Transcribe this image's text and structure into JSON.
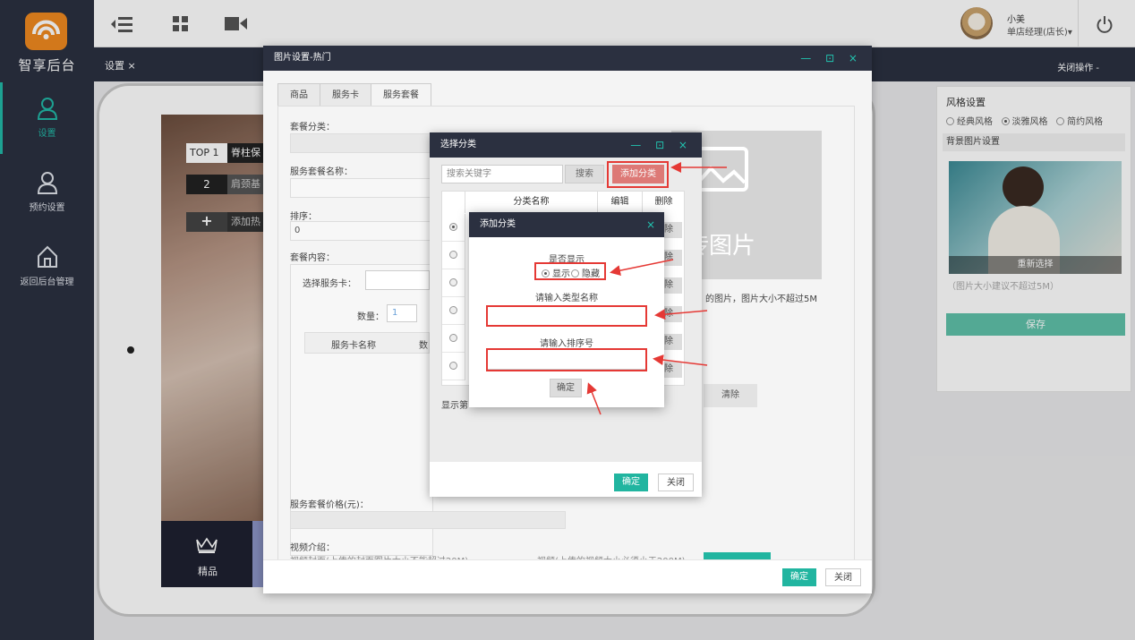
{
  "brand": {
    "name": "智享后台"
  },
  "sidebar": {
    "items": [
      {
        "label": "设置",
        "icon": "user-icon"
      },
      {
        "label": "预约设置",
        "icon": "user-icon"
      },
      {
        "label": "返回后台管理",
        "icon": "home-icon"
      }
    ]
  },
  "user": {
    "name": "小美",
    "role": "单店经理(店长)",
    "arrow": "▾"
  },
  "tabbar": {
    "tab": "设置 ×",
    "close_ops": "关闭操作 -"
  },
  "phone": {
    "top1_tag": "TOP 1",
    "top1_text": "脊柱保",
    "rank2": "2",
    "rank2_text": "肩颈基",
    "add_text": "添加热",
    "bottom_label": "精品"
  },
  "right_panel": {
    "style_title": "风格设置",
    "styles": [
      "经典风格",
      "淡雅风格",
      "简约风格"
    ],
    "bg_title": "背景图片设置",
    "reselect": "重新选择",
    "hint": "（图片大小建议不超过5M）",
    "save": "保存"
  },
  "dialog1": {
    "title": "图片设置-热门",
    "controls": "— ⊡ ×",
    "tabs": [
      "商品",
      "服务卡",
      "服务套餐"
    ],
    "package_category_label": "套餐分类：",
    "package_name_label": "服务套餐名称：",
    "sort_label": "排序：",
    "sort_value": "0",
    "content_label": "套餐内容：",
    "select_card_label": "选择服务卡：",
    "qty_label": "数量：",
    "qty_value": "1",
    "card_col": "服务卡名称",
    "qty_col": "数",
    "upload_big": "传图片",
    "upload_hint": "的图片，图片大小不超过5M",
    "clear": "清除",
    "price_label": "服务套餐价格(元)：",
    "video_label": "视频介绍：",
    "video_hint1": "视频封面(上传的封面图片大小不能超过20M)",
    "video_hint2": "视频(上传的视频大小必须小于200M)",
    "ok": "确定",
    "close": "关闭"
  },
  "dialog2": {
    "title": "选择分类",
    "controls": "— ⊡ ×",
    "search_placeholder": "搜索关键字",
    "search_btn": "搜索",
    "add_btn": "添加分类",
    "col_name": "分类名称",
    "col_edit": "编辑",
    "col_del": "删除",
    "del_fragment": "除",
    "page_info": "显示第",
    "ok": "确定",
    "close": "关闭"
  },
  "dialog3": {
    "title": "添加分类",
    "close": "×",
    "show_label": "是否显示",
    "show_yes": "显示",
    "show_no": "隐藏",
    "name_label": "请输入类型名称",
    "sort_label": "请输入排序号",
    "ok": "确定"
  },
  "colors": {
    "sidebar": "#2b3040",
    "accent": "#22b8a7",
    "danger": "#e53935"
  }
}
